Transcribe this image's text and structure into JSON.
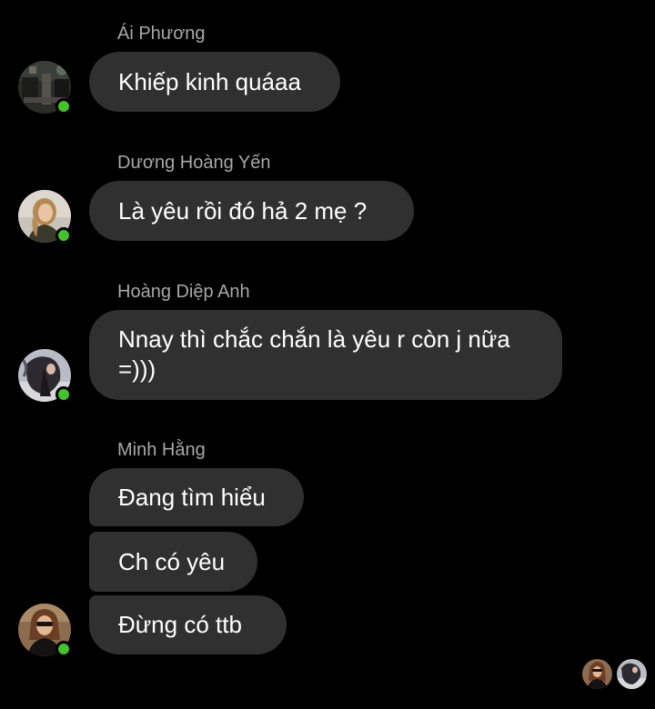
{
  "colors": {
    "background": "#000000",
    "bubble": "#303030",
    "sender_name": "#a8a8a8",
    "online_dot": "#44c22b"
  },
  "messages": [
    {
      "sender": "Ái Phương",
      "bubbles": [
        "Khiếp kinh quáaa"
      ],
      "avatar_icon": "profile-photo-ai-phuong"
    },
    {
      "sender": "Dương Hoàng Yến",
      "bubbles": [
        "Là yêu rồi đó hả 2 mẹ ?"
      ],
      "avatar_icon": "profile-photo-duong-hoang-yen"
    },
    {
      "sender": "Hoàng Diệp Anh",
      "bubbles": [
        "Nnay thì chắc chắn là yêu r còn j nữa =)))"
      ],
      "avatar_icon": "profile-photo-hoang-diep-anh"
    },
    {
      "sender": "Minh Hằng",
      "bubbles": [
        "Đang tìm hiểu",
        "Ch có yêu",
        "Đừng có ttb"
      ],
      "avatar_icon": "profile-photo-minh-hang"
    }
  ],
  "seen_by": [
    "profile-photo-minh-hang",
    "profile-photo-hoang-diep-anh"
  ]
}
